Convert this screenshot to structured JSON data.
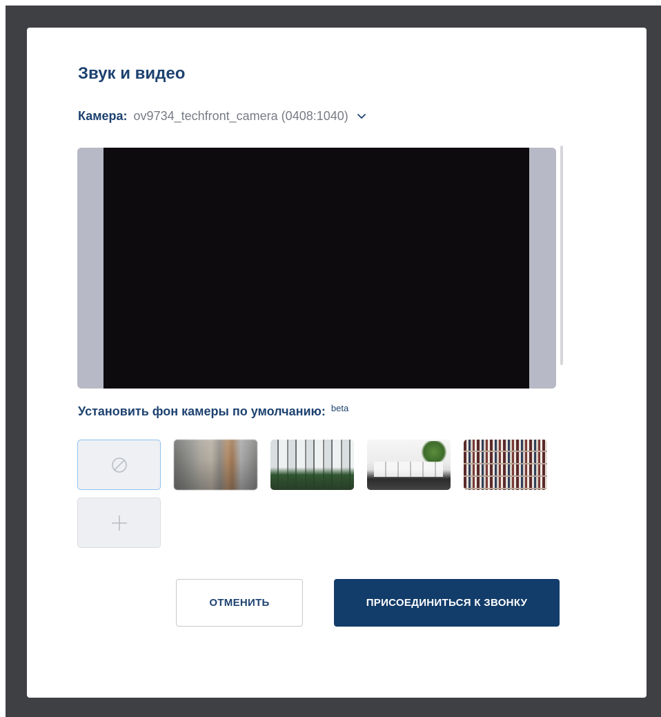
{
  "dialog": {
    "title": "Звук и видео",
    "camera": {
      "label": "Камера:",
      "selected": "ov9734_techfront_camera (0408:1040)",
      "dropdown_icon": "chevron-down-icon"
    },
    "background": {
      "label": "Установить фон камеры по умолчанию:",
      "badge": "beta",
      "options": [
        {
          "name": "none",
          "icon": "no-background-icon",
          "selected": true
        },
        {
          "name": "blur",
          "selected": false
        },
        {
          "name": "office-1",
          "selected": false
        },
        {
          "name": "office-2",
          "selected": false
        },
        {
          "name": "bookshelf",
          "selected": false
        }
      ],
      "add_icon": "plus-icon"
    },
    "buttons": {
      "cancel": "ОТМЕНИТЬ",
      "join": "ПРИСОЕДИНИТЬСЯ К ЗВОНКУ"
    }
  },
  "colors": {
    "accent": "#1d4270",
    "primary_button": "#123c69",
    "backdrop": "#3f4044",
    "selected_border": "#8ec3f0"
  }
}
